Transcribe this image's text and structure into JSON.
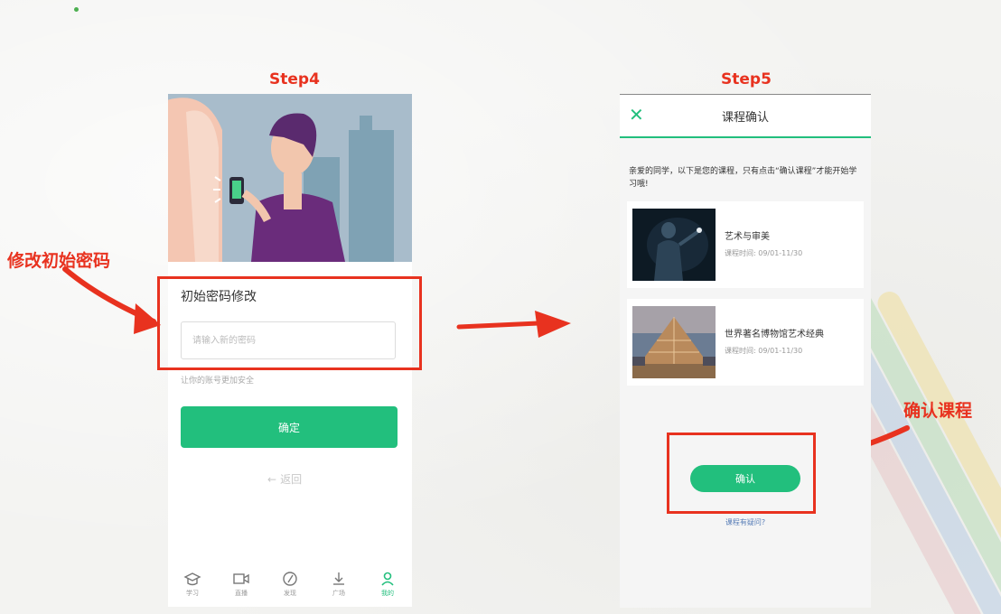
{
  "steps": {
    "step4": "Step4",
    "step5": "Step5"
  },
  "annotations": {
    "change_password": "修改初始密码",
    "confirm_course": "确认课程"
  },
  "screen1": {
    "form_title": "初始密码修改",
    "password_placeholder": "请输入新的密码",
    "hint": "让你的账号更加安全",
    "confirm_label": "确定",
    "back_label": "返回",
    "nav": [
      {
        "label": "学习",
        "icon": "graduation-cap-icon"
      },
      {
        "label": "直播",
        "icon": "video-camera-icon"
      },
      {
        "label": "发现",
        "icon": "compass-icon"
      },
      {
        "label": "广场",
        "icon": "plaza-icon"
      },
      {
        "label": "我的",
        "icon": "user-icon"
      }
    ]
  },
  "screen2": {
    "title": "课程确认",
    "intro": "亲爱的同学，以下是您的课程，只有点击“确认课程”才能开始学习哦!",
    "courses": [
      {
        "name": "艺术与审美",
        "time": "课程时间: 09/01-11/30"
      },
      {
        "name": "世界著名博物馆艺术经典",
        "time": "课程时间: 09/01-11/30"
      }
    ],
    "confirm_label": "确认",
    "question_label": "课程有疑问?"
  },
  "colors": {
    "accent": "#22bf7d",
    "annotation": "#e8321f"
  }
}
